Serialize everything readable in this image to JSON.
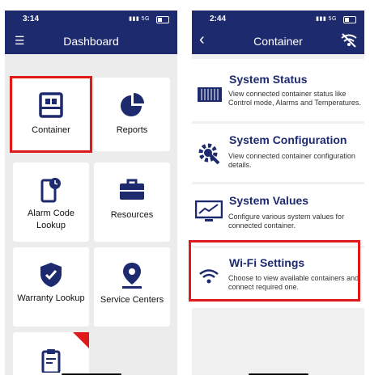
{
  "left": {
    "status_time": "3:14",
    "status_network": "5G",
    "title": "Dashboard",
    "tiles": [
      {
        "label": "Container"
      },
      {
        "label": "Reports"
      },
      {
        "label": "Alarm Code Lookup"
      },
      {
        "label": "Resources"
      },
      {
        "label": "Warranty Lookup"
      },
      {
        "label": "Service Centers"
      },
      {
        "label": ""
      }
    ]
  },
  "right": {
    "status_time": "2:44",
    "status_network": "5G",
    "title": "Container",
    "items": [
      {
        "title": "System Status",
        "desc": "View connected container status like Control mode, Alarms and Temperatures."
      },
      {
        "title": "System Configuration",
        "desc": "View connected container configuration details."
      },
      {
        "title": "System Values",
        "desc": "Configure various system values for connected container."
      },
      {
        "title": "Wi-Fi Settings",
        "desc": "Choose to view available containers and connect required one."
      }
    ]
  },
  "colors": {
    "brand": "#1e2a6e",
    "highlight": "#e0191a"
  }
}
